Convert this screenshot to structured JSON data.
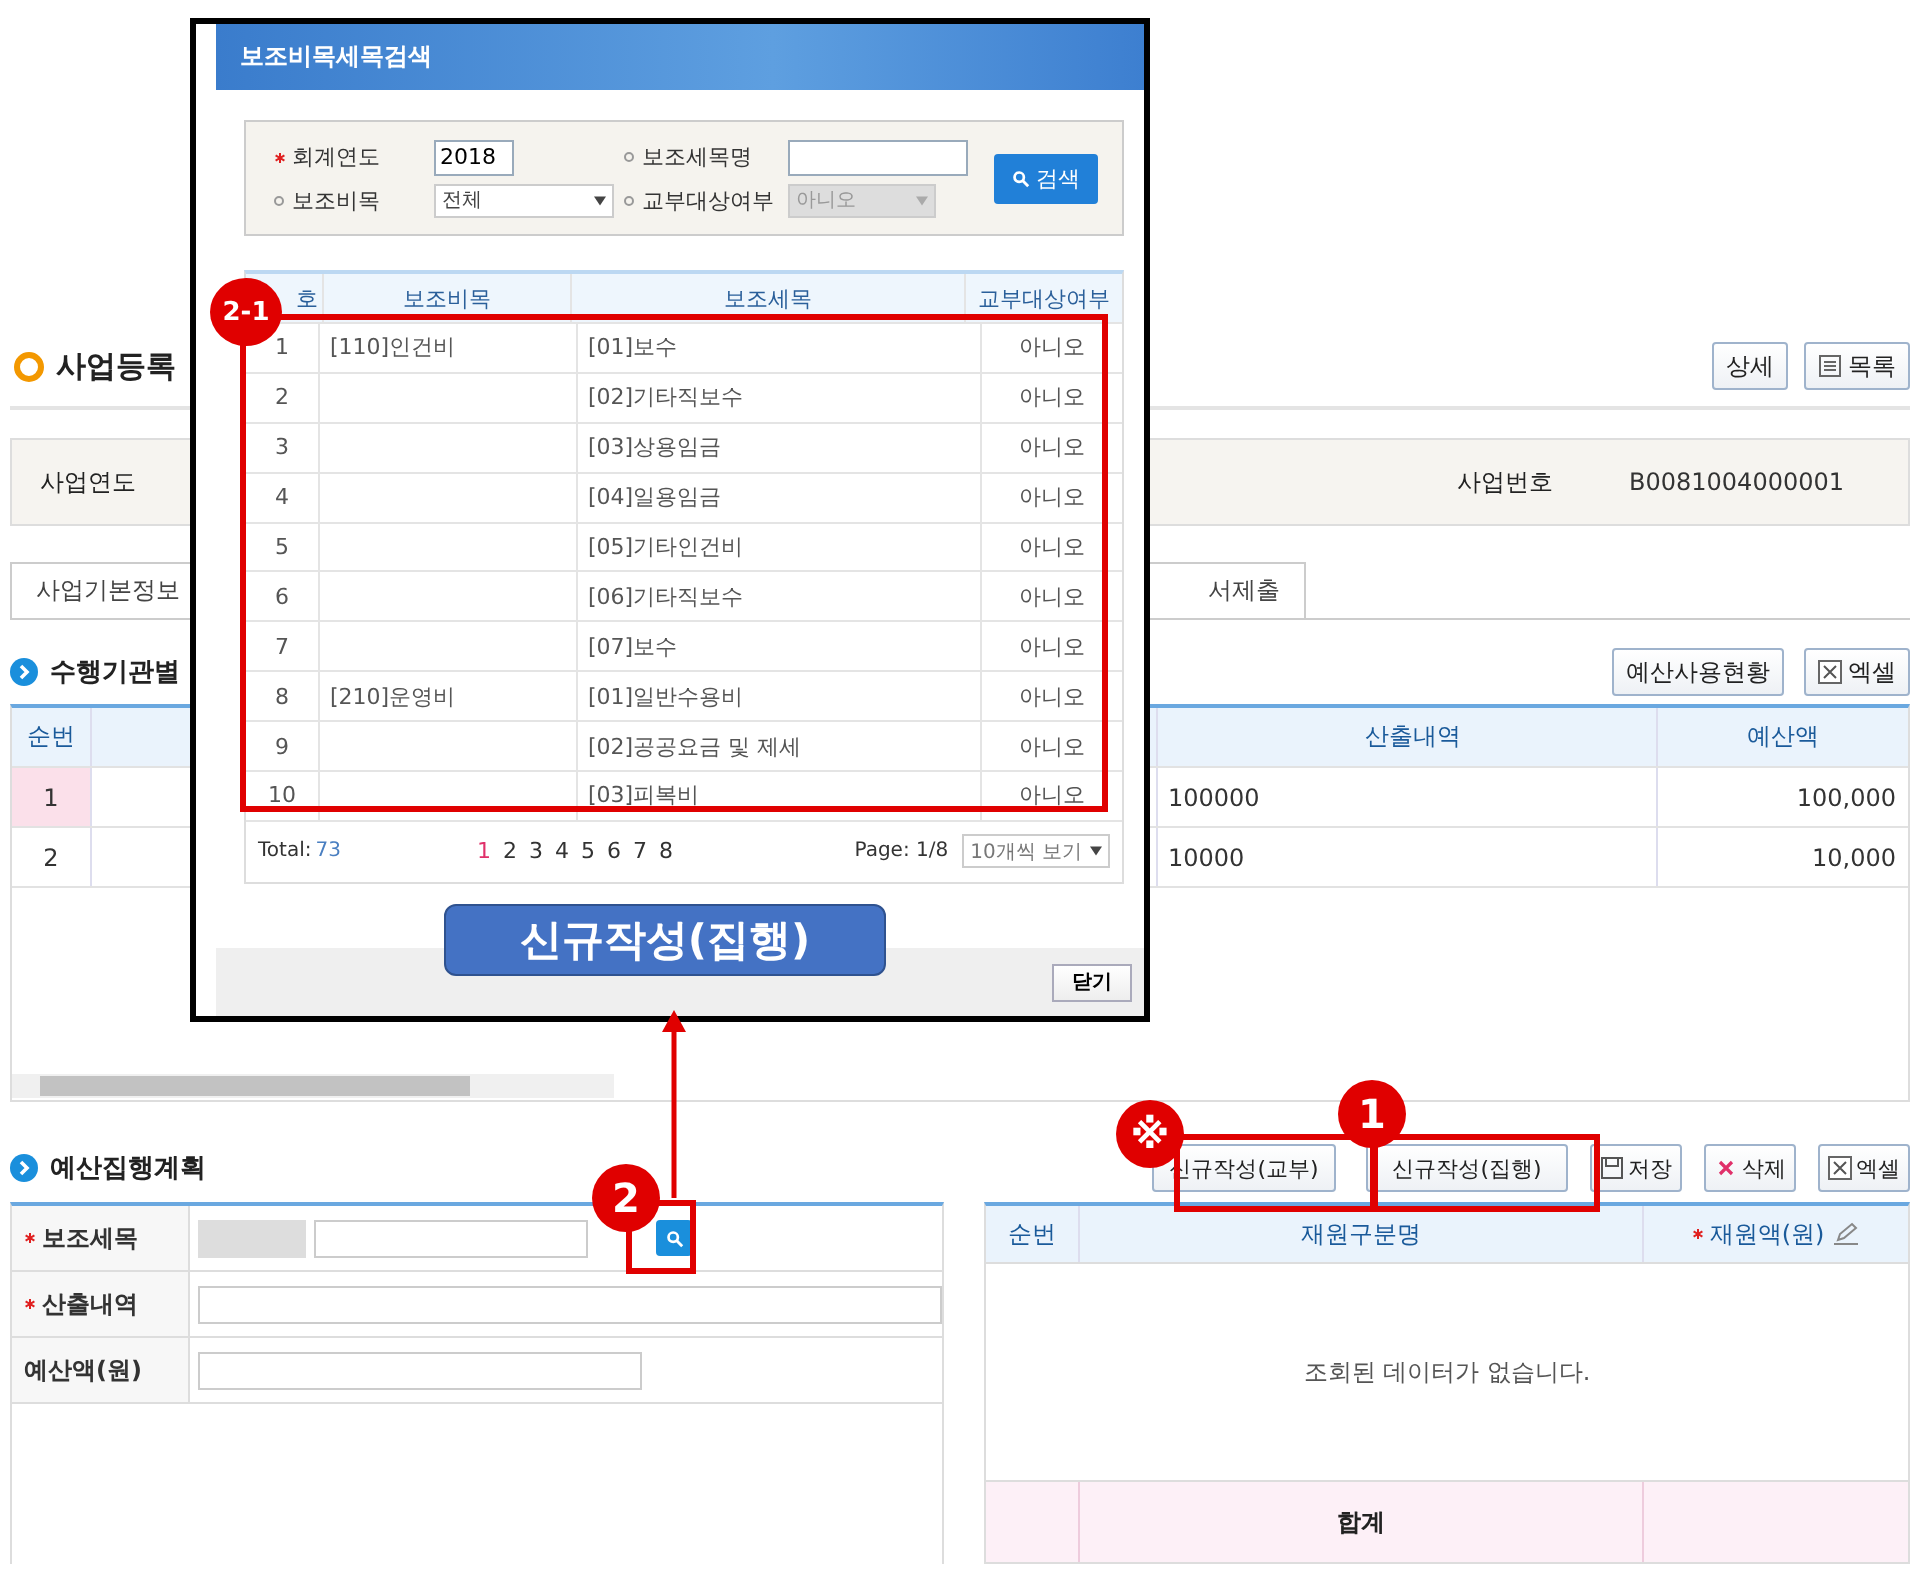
{
  "page": {
    "title": "사업등록",
    "buttons": [
      {
        "label": "상세",
        "kind": "plain"
      },
      {
        "label": "목록",
        "kind": "list"
      }
    ]
  },
  "info": {
    "year_label": "사업연도",
    "number_label": "사업번호",
    "number_value": "B0081004000001"
  },
  "tabs": [
    {
      "label": "사업기본정보",
      "selected": false
    },
    {
      "label": "서제출",
      "selected": false
    }
  ],
  "agency_section": {
    "title": "수행기관별",
    "buttons": [
      {
        "label": "예산사용현황",
        "kind": "plain"
      },
      {
        "label": "엑셀",
        "kind": "excel"
      }
    ]
  },
  "agency_table": {
    "columns": [
      "순번",
      "산출내역",
      "예산액"
    ],
    "rows": [
      {
        "no": "1",
        "detail": "100000",
        "amount": "100,000",
        "selected": true
      },
      {
        "no": "2",
        "detail": "10000",
        "amount": "10,000",
        "selected": false
      }
    ]
  },
  "plan_section": {
    "title": "예산집행계획",
    "buttons": [
      {
        "label": "신규작성(교부)",
        "kind": "plain"
      },
      {
        "label": "신규작성(집행)",
        "kind": "plain"
      },
      {
        "label": "저장",
        "kind": "save"
      },
      {
        "label": "삭제",
        "kind": "delete"
      },
      {
        "label": "엑셀",
        "kind": "excel"
      }
    ]
  },
  "plan_form": [
    {
      "label": "보조세목",
      "required": true,
      "kind": "search"
    },
    {
      "label": "산출내역",
      "required": true,
      "kind": "wide"
    },
    {
      "label": "예산액(원)",
      "required": false,
      "kind": "short"
    }
  ],
  "funding_table": {
    "columns": [
      {
        "label": "순번",
        "required": false,
        "editable": false
      },
      {
        "label": "재원구분명",
        "required": false,
        "editable": false
      },
      {
        "label": "재원액(원)",
        "required": true,
        "editable": true
      }
    ],
    "empty_message": "조회된 데이터가 없습니다.",
    "total_label": "합계"
  },
  "modal": {
    "title": "보조비목세목검색",
    "search_fields": [
      {
        "label": "회계연도",
        "required": true,
        "kind": "input",
        "value": "2018",
        "disabled": false
      },
      {
        "label": "보조세목명",
        "required": false,
        "kind": "input",
        "disabled": false
      },
      {
        "label": "보조비목",
        "required": false,
        "kind": "select",
        "value": "전체",
        "disabled": false
      },
      {
        "label": "교부대상여부",
        "required": false,
        "kind": "select",
        "value": "아니오",
        "disabled": true
      }
    ],
    "search_button": "검색",
    "columns": [
      "호",
      "보조비목",
      "보조세목",
      "교부대상여부"
    ],
    "rows": [
      {
        "no": "1",
        "category": "[110]인건비",
        "item": "[01]보수",
        "granted": "아니오"
      },
      {
        "no": "2",
        "item": "[02]기타직보수",
        "granted": "아니오"
      },
      {
        "no": "3",
        "item": "[03]상용임금",
        "granted": "아니오"
      },
      {
        "no": "4",
        "item": "[04]일용임금",
        "granted": "아니오"
      },
      {
        "no": "5",
        "item": "[05]기타인건비",
        "granted": "아니오"
      },
      {
        "no": "6",
        "item": "[06]기타직보수",
        "granted": "아니오"
      },
      {
        "no": "7",
        "item": "[07]보수",
        "granted": "아니오"
      },
      {
        "no": "8",
        "category": "[210]운영비",
        "item": "[01]일반수용비",
        "granted": "아니오"
      },
      {
        "no": "9",
        "item": "[02]공공요금 및 제세",
        "granted": "아니오"
      },
      {
        "no": "10",
        "item": "[03]피복비",
        "granted": "아니오"
      }
    ],
    "total_label": "Total:",
    "total": "73",
    "pages": [
      {
        "label": "1",
        "selected": true
      },
      {
        "label": "2",
        "selected": false
      },
      {
        "label": "3",
        "selected": false
      },
      {
        "label": "4",
        "selected": false
      },
      {
        "label": "5",
        "selected": false
      },
      {
        "label": "6",
        "selected": false
      },
      {
        "label": "7",
        "selected": false
      },
      {
        "label": "8",
        "selected": false
      }
    ],
    "page_info": "Page: 1/8",
    "page_size": "10개씩 보기",
    "close_button": "닫기"
  },
  "annotations": {
    "callout": "신규작성(집행)",
    "badges": [
      "2-1",
      "2",
      "※",
      "1"
    ]
  }
}
